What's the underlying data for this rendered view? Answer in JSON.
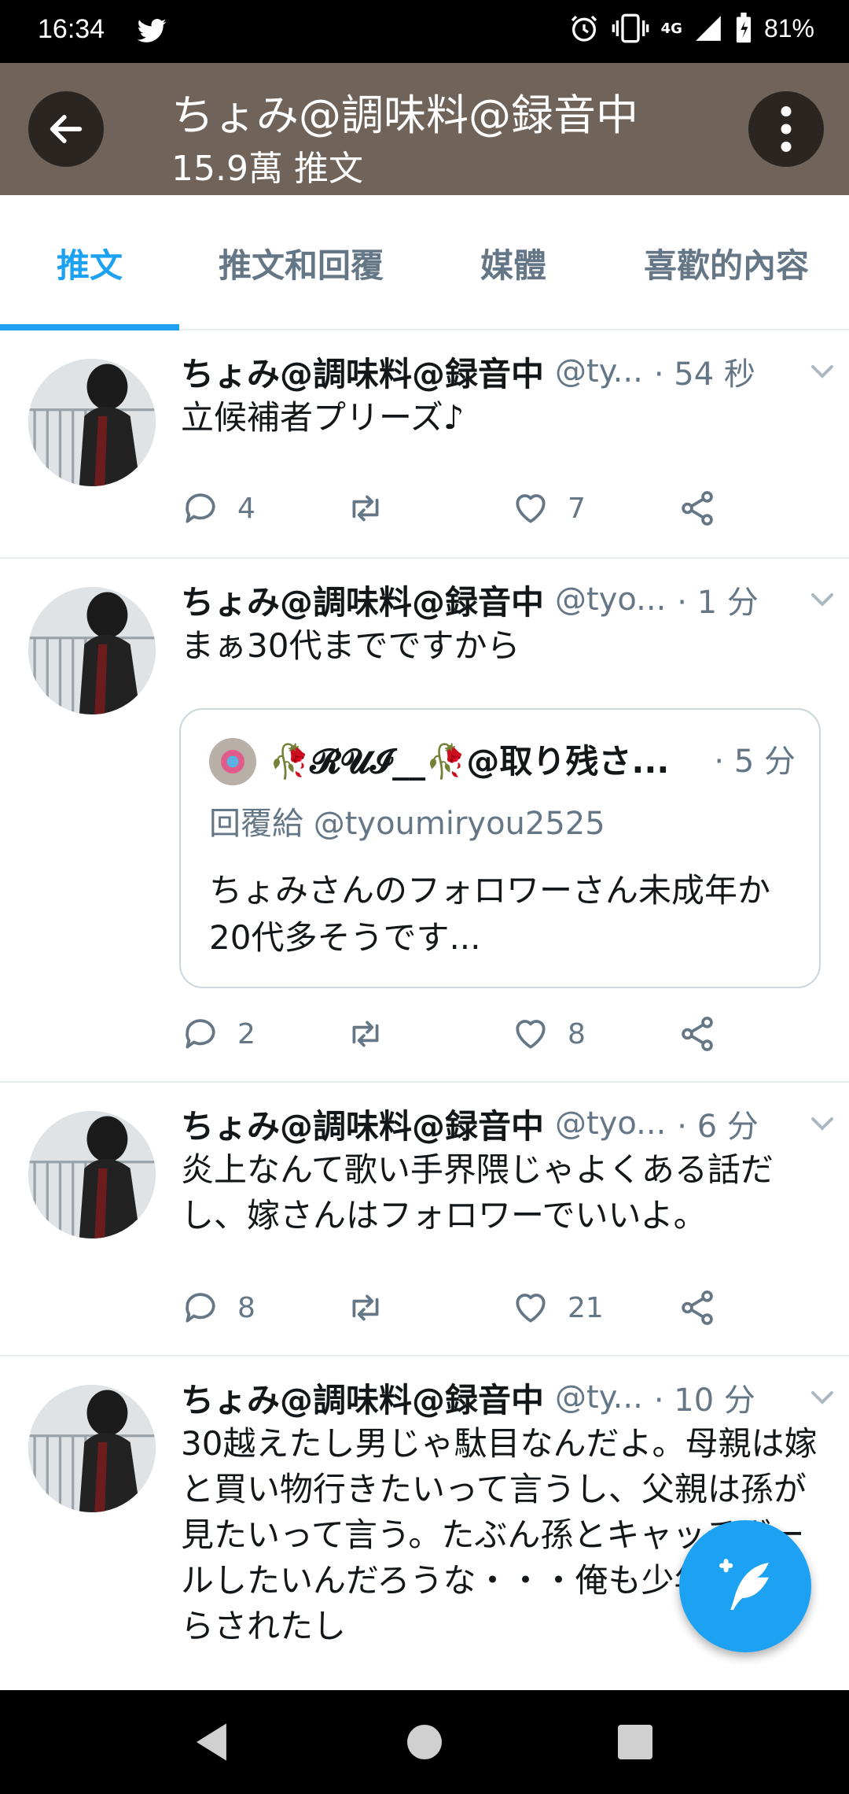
{
  "status_bar": {
    "time": "16:34",
    "network": "4G",
    "battery": "81%",
    "icons": [
      "twitter-bird-icon",
      "alarm-icon",
      "vibrate-icon",
      "signal-icon",
      "battery-icon"
    ]
  },
  "header": {
    "title": "ちょみ@調味料@録音中",
    "subtitle": "15.9萬 推文",
    "back_icon": "arrow-left-icon",
    "more_icon": "more-vertical-icon",
    "background_color": "#6f635a"
  },
  "tabs": [
    {
      "label": "推文",
      "active": true
    },
    {
      "label": "推文和回覆",
      "active": false
    },
    {
      "label": "媒體",
      "active": false
    },
    {
      "label": "喜歡的內容",
      "active": false
    }
  ],
  "accent_color": "#1da1f2",
  "tweets": [
    {
      "name": "ちょみ@調味料@録音中",
      "handle": "@ty...",
      "time": "· 54 秒",
      "text": "立候補者プリーズ♪",
      "replies": "4",
      "likes": "7"
    },
    {
      "name": "ちょみ@調味料@録音中",
      "handle": "@tyo...",
      "time": "· 1 分",
      "text": "まぁ30代までですから",
      "replies": "2",
      "likes": "8",
      "quote": {
        "name": "🥀𝓡𝓤𝓘__🥀@取り残さ...",
        "time": "· 5 分",
        "reply_to": "回覆給 @tyoumiryou2525",
        "text": "ちょみさんのフォロワーさん未成年か20代多そうです..."
      }
    },
    {
      "name": "ちょみ@調味料@録音中",
      "handle": "@tyo...",
      "time": "· 6 分",
      "text": "炎上なんて歌い手界隈じゃよくある話だし、嫁さんはフォロワーでいいよ。",
      "replies": "8",
      "likes": "21"
    },
    {
      "name": "ちょみ@調味料@録音中",
      "handle": "@ty...",
      "time": "· 10 分",
      "text": "30越えたし男じゃ駄目なんだよ。母親は嫁と買い物行きたいって言うし、父親は孫が見たいって言う。たぶん孫とキャッチボールしたいんだろうな・・・俺も少年野球やらされたし"
    }
  ],
  "fab": {
    "icon": "compose-tweet-icon"
  },
  "nav_bar": {
    "icons": [
      "nav-back-icon",
      "nav-home-icon",
      "nav-recents-icon"
    ]
  }
}
